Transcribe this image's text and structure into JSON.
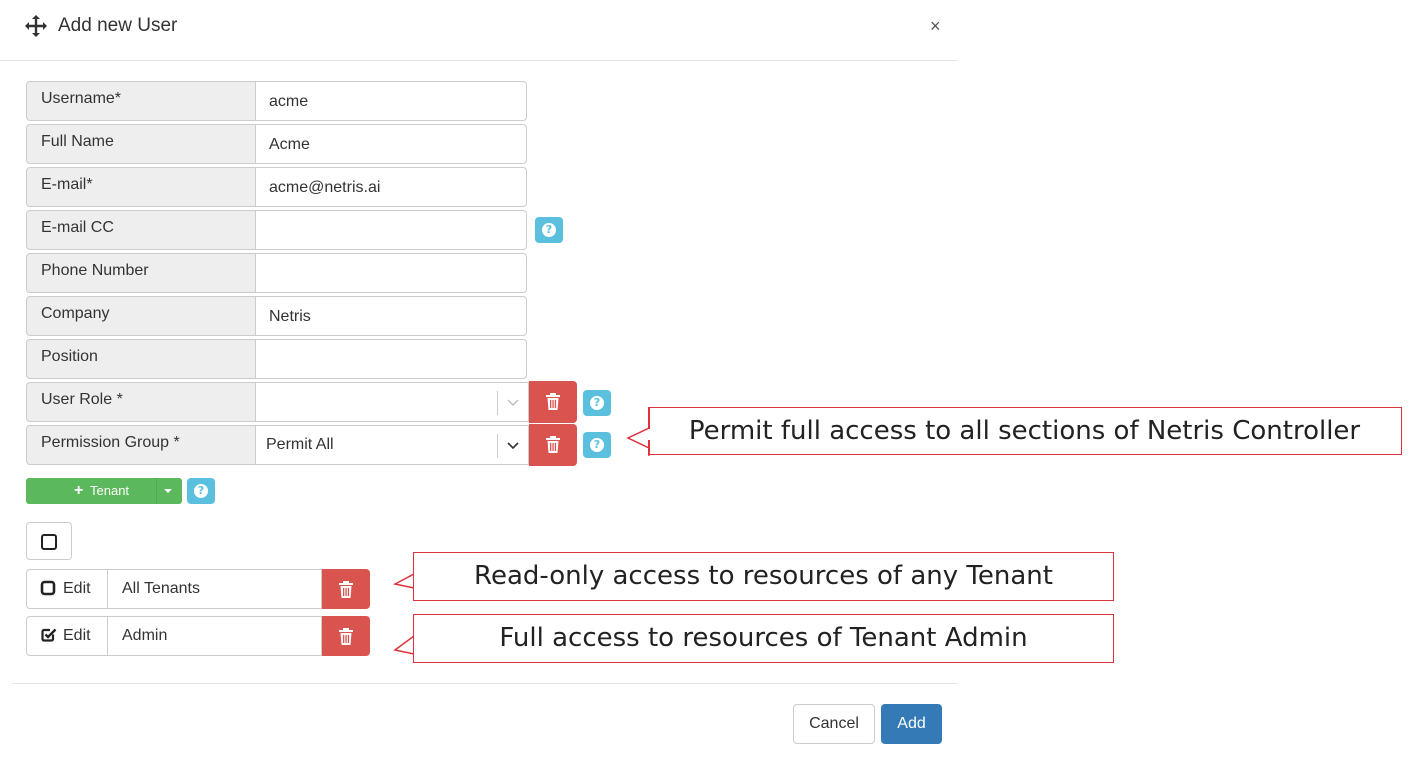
{
  "dialog": {
    "title": "Add new User",
    "close_label": "×"
  },
  "fields": [
    {
      "label": "Username*",
      "value": "acme"
    },
    {
      "label": "Full Name",
      "value": "Acme"
    },
    {
      "label": "E-mail*",
      "value": "acme@netris.ai"
    },
    {
      "label": "E-mail CC",
      "value": ""
    },
    {
      "label": "Phone Number",
      "value": ""
    },
    {
      "label": "Company",
      "value": "Netris"
    },
    {
      "label": "Position",
      "value": ""
    }
  ],
  "user_role": {
    "label": "User Role *",
    "value": ""
  },
  "permission_group": {
    "label": "Permission Group *",
    "value": "Permit All"
  },
  "tenant_button": {
    "plus": "+",
    "label": "Tenant"
  },
  "tenants": [
    {
      "edit_label": "Edit",
      "name": "All Tenants",
      "edit_checked": false
    },
    {
      "edit_label": "Edit",
      "name": "Admin",
      "edit_checked": true
    }
  ],
  "annotations": {
    "permission_note": "Permit full access to all sections of Netris Controller",
    "all_tenants_note": "Read-only access to resources of any Tenant",
    "admin_note": "Full access to resources of Tenant Admin"
  },
  "footer": {
    "cancel_label": "Cancel",
    "add_label": "Add"
  },
  "colors": {
    "danger": "#d9534f",
    "info": "#5bc0de",
    "success": "#5cb85c",
    "primary": "#337ab7",
    "callout_border": "#e0323c"
  }
}
